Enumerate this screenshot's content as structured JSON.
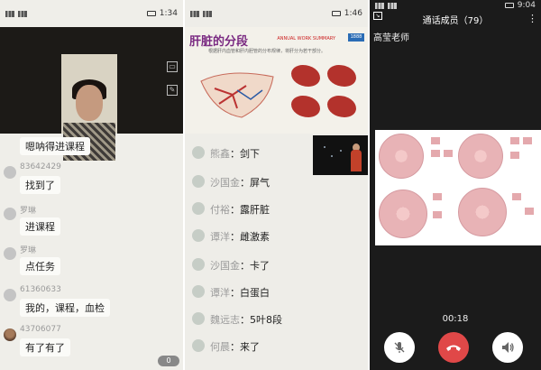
{
  "panel_left": {
    "statusbar": {
      "left": "☰ ᴴᴰ •••",
      "right": "1:34"
    },
    "messages": [
      {
        "sender": "",
        "text": "嗯呐得进课程"
      },
      {
        "sender": "83642429",
        "text": "找到了"
      },
      {
        "sender": "罗琳",
        "text": "进课程"
      },
      {
        "sender": "罗琳",
        "text": "点任务"
      },
      {
        "sender": "61360633",
        "text": "我的，课程，血检"
      },
      {
        "sender": "43706077",
        "text": "有了有了"
      }
    ],
    "counter": "0"
  },
  "panel_mid": {
    "statusbar": {
      "right": "1:46"
    },
    "slide": {
      "title": "肝脏的分段",
      "tag": "ANNUAL WORK SUMMARY",
      "badge": "1888",
      "subtitle": "根据肝内血管和肝内胆管的分布规律，将肝分为若干部分。"
    },
    "messages": [
      {
        "name": "熊鑫",
        "text": "剑下"
      },
      {
        "name": "沙国金",
        "text": "屏气"
      },
      {
        "name": "付裕",
        "text": "露肝脏"
      },
      {
        "name": "谭洋",
        "text": "雌激素"
      },
      {
        "name": "沙国金",
        "text": "卡了"
      },
      {
        "name": "谭洋",
        "text": "白蛋白"
      },
      {
        "name": "魏远志",
        "text": "5叶8段"
      },
      {
        "name": "何晨",
        "text": "来了"
      }
    ]
  },
  "panel_right": {
    "statusbar": {
      "right": "9:04"
    },
    "title": "通话成员（79）",
    "more": "⋮",
    "teacher": "高莹老师",
    "timer": "00:18",
    "buttons": {
      "mute_icon": "mic-off-icon",
      "hangup_icon": "phone-hangup-icon",
      "speaker_icon": "speaker-icon"
    },
    "colors": {
      "hangup": "#e04848",
      "background": "#1b1b1b"
    }
  }
}
